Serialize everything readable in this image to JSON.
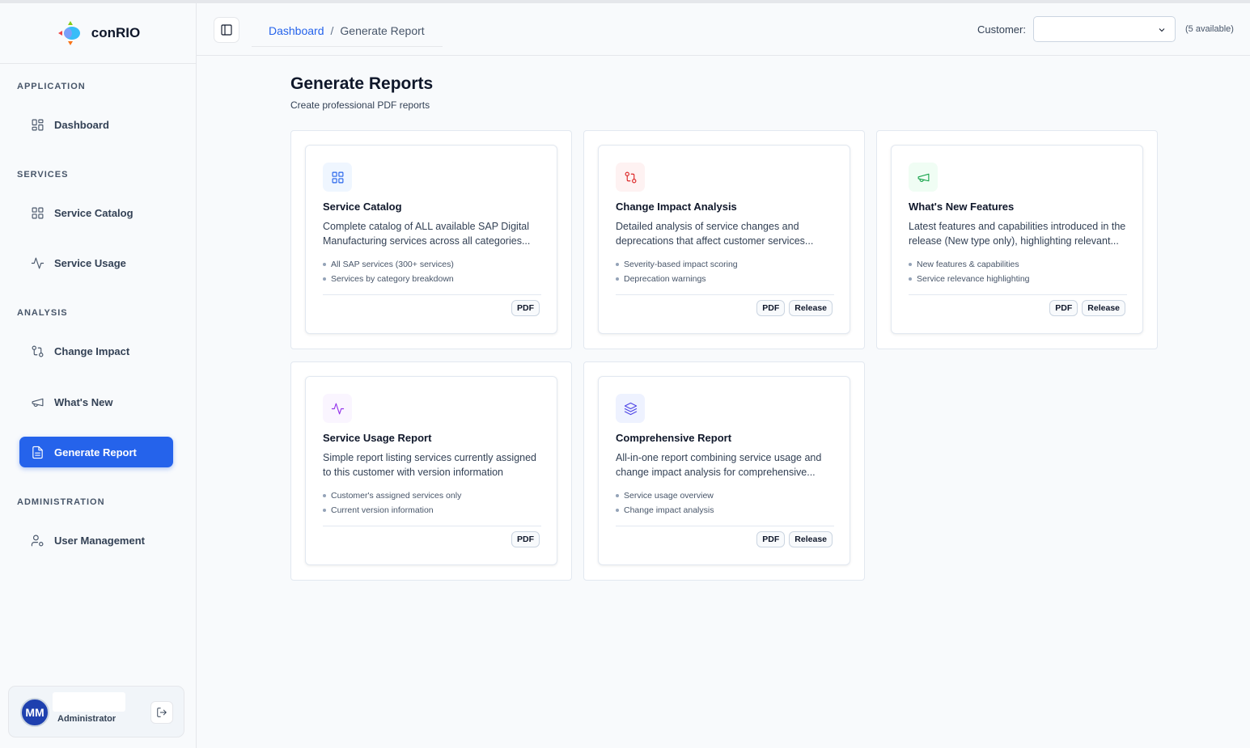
{
  "app": {
    "name": "conRIO"
  },
  "sidebar": {
    "sections": [
      {
        "title": "APPLICATION",
        "items": [
          {
            "label": "Dashboard",
            "icon": "grid-icon"
          }
        ]
      },
      {
        "title": "SERVICES",
        "items": [
          {
            "label": "Service Catalog",
            "icon": "grid-icon"
          },
          {
            "label": "Service Usage",
            "icon": "activity-icon"
          }
        ]
      },
      {
        "title": "ANALYSIS",
        "items": [
          {
            "label": "Change Impact",
            "icon": "git-compare-icon"
          },
          {
            "label": "What's New",
            "icon": "megaphone-icon"
          },
          {
            "label": "Generate Report",
            "icon": "file-text-icon",
            "active": true
          }
        ]
      },
      {
        "title": "ADMINISTRATION",
        "items": [
          {
            "label": "User Management",
            "icon": "user-cog-icon"
          }
        ]
      }
    ],
    "user": {
      "initials": "MM",
      "role": "Administrator"
    }
  },
  "header": {
    "breadcrumb": {
      "link": "Dashboard",
      "separator": "/",
      "current": "Generate Report"
    },
    "customer": {
      "label": "Customer:",
      "value": "",
      "available": "(5 available)"
    }
  },
  "main": {
    "title": "Generate Reports",
    "subtitle": "Create professional PDF reports",
    "cards": [
      {
        "title": "Service Catalog",
        "icon": "grid-icon",
        "icon_color": "#2563eb",
        "icon_bg": "#eff6ff",
        "desc_line1": "Complete catalog of ALL available SAP Digital",
        "desc_line2": "Manufacturing services across all categories...",
        "bullets": [
          "All SAP services (300+ services)",
          "Services by category breakdown"
        ],
        "badges": [
          "PDF"
        ]
      },
      {
        "title": "Change Impact Analysis",
        "icon": "git-compare-icon",
        "icon_color": "#dc2626",
        "icon_bg": "#fef2f2",
        "desc_line1": "Detailed analysis of service changes and",
        "desc_line2": "deprecations that affect customer services...",
        "bullets": [
          "Severity-based impact scoring",
          "Deprecation warnings"
        ],
        "badges": [
          "PDF",
          "Release"
        ]
      },
      {
        "title": "What's New Features",
        "icon": "megaphone-icon",
        "icon_color": "#16a34a",
        "icon_bg": "#f0fdf4",
        "desc_line1": "Latest features and capabilities introduced in the",
        "desc_line2": "release (New type only), highlighting relevant...",
        "bullets": [
          "New features & capabilities",
          "Service relevance highlighting"
        ],
        "badges": [
          "PDF",
          "Release"
        ]
      },
      {
        "title": "Service Usage Report",
        "icon": "activity-icon",
        "icon_color": "#9333ea",
        "icon_bg": "#faf5ff",
        "desc_line1": "Simple report listing services currently assigned",
        "desc_line2": "to this customer with version information",
        "bullets": [
          "Customer's assigned services only",
          "Current version information"
        ],
        "badges": [
          "PDF"
        ]
      },
      {
        "title": "Comprehensive Report",
        "icon": "layers-icon",
        "icon_color": "#4f46e5",
        "icon_bg": "#eef2ff",
        "desc_line1": "All-in-one report combining service usage and",
        "desc_line2": "change impact analysis for comprehensive...",
        "bullets": [
          "Service usage overview",
          "Change impact analysis"
        ],
        "badges": [
          "PDF",
          "Release"
        ]
      }
    ]
  }
}
